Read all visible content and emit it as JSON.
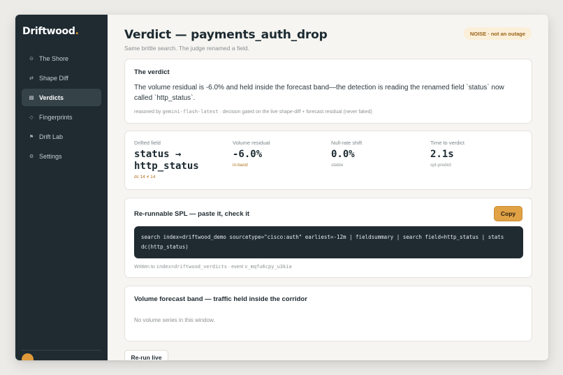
{
  "brand": {
    "name": "Driftwood",
    "dot": "."
  },
  "nav": [
    {
      "label": "The Shore",
      "icon": "⊙"
    },
    {
      "label": "Shape Diff",
      "icon": "⇄"
    },
    {
      "label": "Verdicts",
      "icon": "▤"
    },
    {
      "label": "Fingerprints",
      "icon": "◇"
    },
    {
      "label": "Drift Lab",
      "icon": "⚑"
    },
    {
      "label": "Settings",
      "icon": "⚙"
    }
  ],
  "active_nav": "Verdicts",
  "page": {
    "title": "Verdict — payments_auth_drop",
    "subtitle": "Same brittle search. The judge renamed a field.",
    "badge": "NOISE · not an outage"
  },
  "verdict": {
    "title": "The verdict",
    "text": "The volume residual is -6.0% and held inside the forecast band—the detection is reading the renamed field `status` now called `http_status`.",
    "meta_prefix": "reasoned by ",
    "model": "gemini-flash-latest",
    "meta_suffix": " · decision gated on the live shape-diff + forecast residual (never faked)"
  },
  "metrics": {
    "drifted_field": {
      "label": "Drifted field",
      "value_line1": "status →",
      "value_line2": "http_status",
      "detail": "dc 14 ≠ 14"
    },
    "volume_residual": {
      "label": "Volume residual",
      "value": "-6.0%",
      "note": "in-band"
    },
    "null_rate": {
      "label": "Null-rate shift",
      "value": "0.0%",
      "note": "stable"
    },
    "time_to_verdict": {
      "label": "Time to verdict",
      "value": "2.1s",
      "note": "spl-predict"
    }
  },
  "spl": {
    "title": "Re-runnable SPL — paste it, check it",
    "copy_label": "Copy",
    "code": "search index=driftwood_demo sourcetype=\"cisco:auth\" earliest=-12m | fieldsummary | search field=http_status | stats dc(http_status)",
    "written_prefix": "Written to ",
    "index": "index=driftwood_verdicts",
    "event_prefix": " · event ",
    "event_id": "v_mqfu6cpy_u3kia"
  },
  "forecast": {
    "title": "Volume forecast band — traffic held inside the corridor",
    "empty": "No volume series in this window."
  },
  "rerun_label": "Re-run live",
  "colors": {
    "accent": "#e0a245",
    "sidebar": "#1f2b31",
    "badge_bg": "#fbefd9",
    "badge_text": "#9a6419"
  }
}
